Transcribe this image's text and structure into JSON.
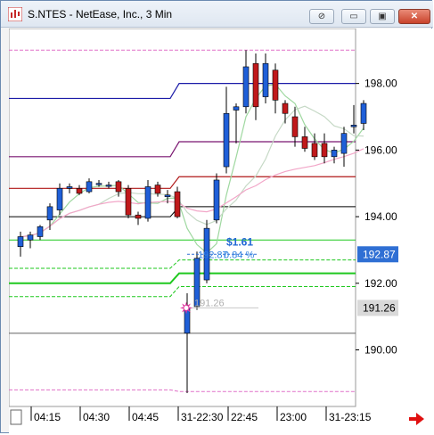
{
  "window": {
    "title": "S.NTES - NetEase, Inc., 3 Min",
    "buttons": {
      "link": "⊘",
      "minimize": "▭",
      "maximize": "▣",
      "close": "✕"
    }
  },
  "chart_data": {
    "type": "candlestick",
    "symbol": "S.NTES",
    "y_ticks": [
      "198.00",
      "196.00",
      "194.00",
      "192.00",
      "190.00"
    ],
    "x_ticks": [
      "04:15",
      "04:30",
      "04:45",
      "31-22:30",
      "22:45",
      "23:00",
      "31-23:15"
    ],
    "ylim": [
      188.3,
      199.65
    ],
    "price_flags": [
      {
        "label": "192.87",
        "value": 192.87,
        "color": "#2f6fd4"
      },
      {
        "label": "191.26",
        "value": 191.26,
        "color": "#d9d9d9"
      }
    ],
    "annotations": {
      "pnl": "$1.61",
      "position_line": "192.87",
      "position_pct": "0.84 %",
      "entry_label": "191.26",
      "entry_price": 191.26
    },
    "candles": [
      {
        "x": 13,
        "o": 193.1,
        "h": 193.55,
        "l": 192.8,
        "c": 193.4
      },
      {
        "x": 24,
        "o": 193.3,
        "h": 193.55,
        "l": 193.05,
        "c": 193.45
      },
      {
        "x": 35,
        "o": 193.4,
        "h": 193.75,
        "l": 193.3,
        "c": 193.7
      },
      {
        "x": 46,
        "o": 193.9,
        "h": 194.4,
        "l": 193.6,
        "c": 194.3
      },
      {
        "x": 57,
        "o": 194.2,
        "h": 195.0,
        "l": 194.05,
        "c": 194.85
      },
      {
        "x": 68,
        "o": 194.85,
        "h": 195.0,
        "l": 194.7,
        "c": 194.9
      },
      {
        "x": 79,
        "o": 194.85,
        "h": 194.95,
        "l": 194.65,
        "c": 194.7
      },
      {
        "x": 90,
        "o": 194.75,
        "h": 195.15,
        "l": 194.7,
        "c": 195.05
      },
      {
        "x": 101,
        "o": 195.0,
        "h": 195.1,
        "l": 194.9,
        "c": 195.0
      },
      {
        "x": 112,
        "o": 194.95,
        "h": 195.05,
        "l": 194.85,
        "c": 194.95
      },
      {
        "x": 123,
        "o": 195.05,
        "h": 195.1,
        "l": 194.6,
        "c": 194.75
      },
      {
        "x": 134,
        "o": 194.85,
        "h": 194.95,
        "l": 193.95,
        "c": 194.05
      },
      {
        "x": 145,
        "o": 194.05,
        "h": 194.15,
        "l": 193.75,
        "c": 193.95
      },
      {
        "x": 156,
        "o": 193.95,
        "h": 195.1,
        "l": 193.85,
        "c": 194.9
      },
      {
        "x": 167,
        "o": 194.95,
        "h": 195.05,
        "l": 194.6,
        "c": 194.7
      },
      {
        "x": 178,
        "o": 194.6,
        "h": 194.8,
        "l": 194.4,
        "c": 194.65
      },
      {
        "x": 189,
        "o": 194.75,
        "h": 194.9,
        "l": 193.95,
        "c": 194.0
      },
      {
        "x": 200,
        "o": 190.5,
        "h": 191.7,
        "l": 188.7,
        "c": 191.25
      },
      {
        "x": 211,
        "o": 191.3,
        "h": 192.95,
        "l": 191.2,
        "c": 192.75
      },
      {
        "x": 222,
        "o": 192.1,
        "h": 193.9,
        "l": 192.0,
        "c": 193.65
      },
      {
        "x": 233,
        "o": 193.9,
        "h": 195.3,
        "l": 193.8,
        "c": 195.1
      },
      {
        "x": 244,
        "o": 195.5,
        "h": 197.9,
        "l": 195.3,
        "c": 197.1
      },
      {
        "x": 255,
        "o": 197.2,
        "h": 197.4,
        "l": 196.2,
        "c": 197.3
      },
      {
        "x": 266,
        "o": 197.3,
        "h": 199.0,
        "l": 197.1,
        "c": 198.5
      },
      {
        "x": 277,
        "o": 198.6,
        "h": 198.9,
        "l": 196.9,
        "c": 197.3
      },
      {
        "x": 288,
        "o": 197.6,
        "h": 198.9,
        "l": 197.4,
        "c": 198.6
      },
      {
        "x": 299,
        "o": 198.4,
        "h": 198.6,
        "l": 197.1,
        "c": 197.5
      },
      {
        "x": 310,
        "o": 197.4,
        "h": 197.5,
        "l": 196.8,
        "c": 197.1
      },
      {
        "x": 321,
        "o": 197.0,
        "h": 197.3,
        "l": 196.1,
        "c": 196.4
      },
      {
        "x": 332,
        "o": 196.4,
        "h": 196.7,
        "l": 195.95,
        "c": 196.05
      },
      {
        "x": 343,
        "o": 196.2,
        "h": 196.5,
        "l": 195.7,
        "c": 195.8
      },
      {
        "x": 354,
        "o": 196.2,
        "h": 196.5,
        "l": 195.6,
        "c": 195.8
      },
      {
        "x": 365,
        "o": 195.8,
        "h": 196.1,
        "l": 195.6,
        "c": 196.0
      },
      {
        "x": 376,
        "o": 195.9,
        "h": 196.7,
        "l": 195.5,
        "c": 196.5
      },
      {
        "x": 387,
        "o": 196.7,
        "h": 197.35,
        "l": 196.5,
        "c": 196.75
      },
      {
        "x": 398,
        "o": 196.8,
        "h": 197.5,
        "l": 196.6,
        "c": 197.4
      }
    ]
  }
}
